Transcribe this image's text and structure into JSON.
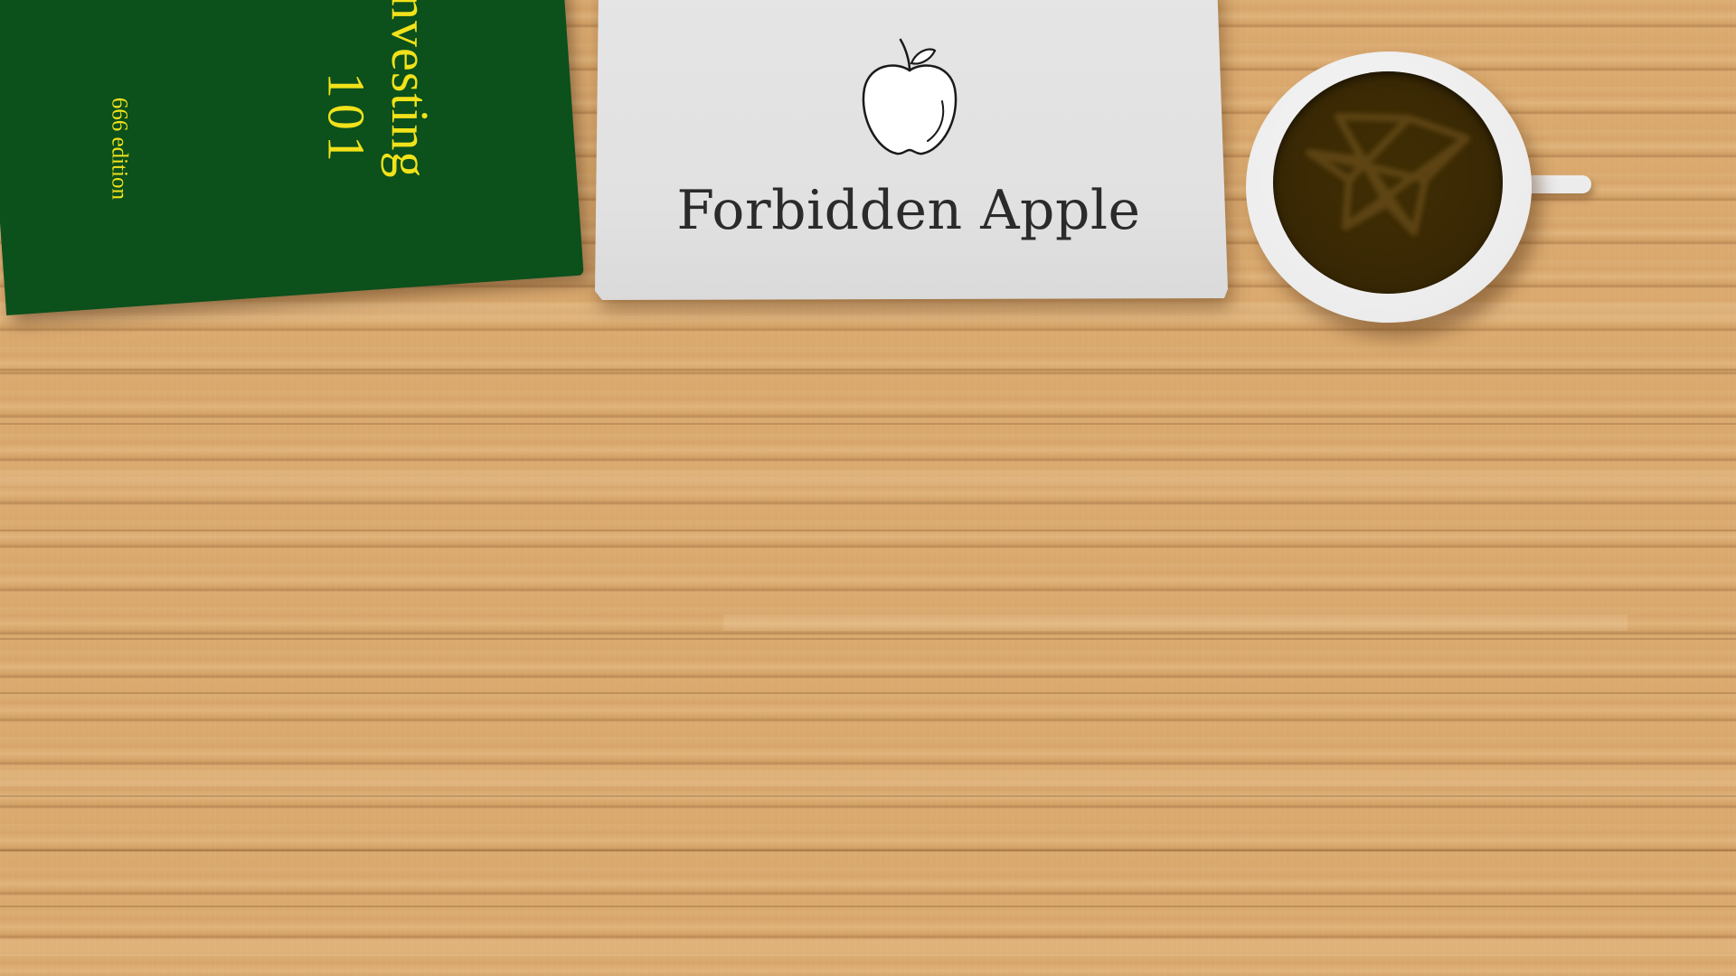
{
  "scene": {
    "background": "wooden-desk",
    "wood_color": "#d9a86c"
  },
  "book": {
    "title": "Investing",
    "number": "101",
    "edition": "666 edition",
    "cover_color": "#0c501c",
    "text_color": "#f2e21a"
  },
  "laptop": {
    "brand_label": "Forbidden Apple",
    "logo_icon": "apple-outline-icon",
    "lid_color": "#e2e2e2"
  },
  "cup": {
    "coffee_color": "#3a2904",
    "latte_art_icon": "pentagram-icon"
  }
}
